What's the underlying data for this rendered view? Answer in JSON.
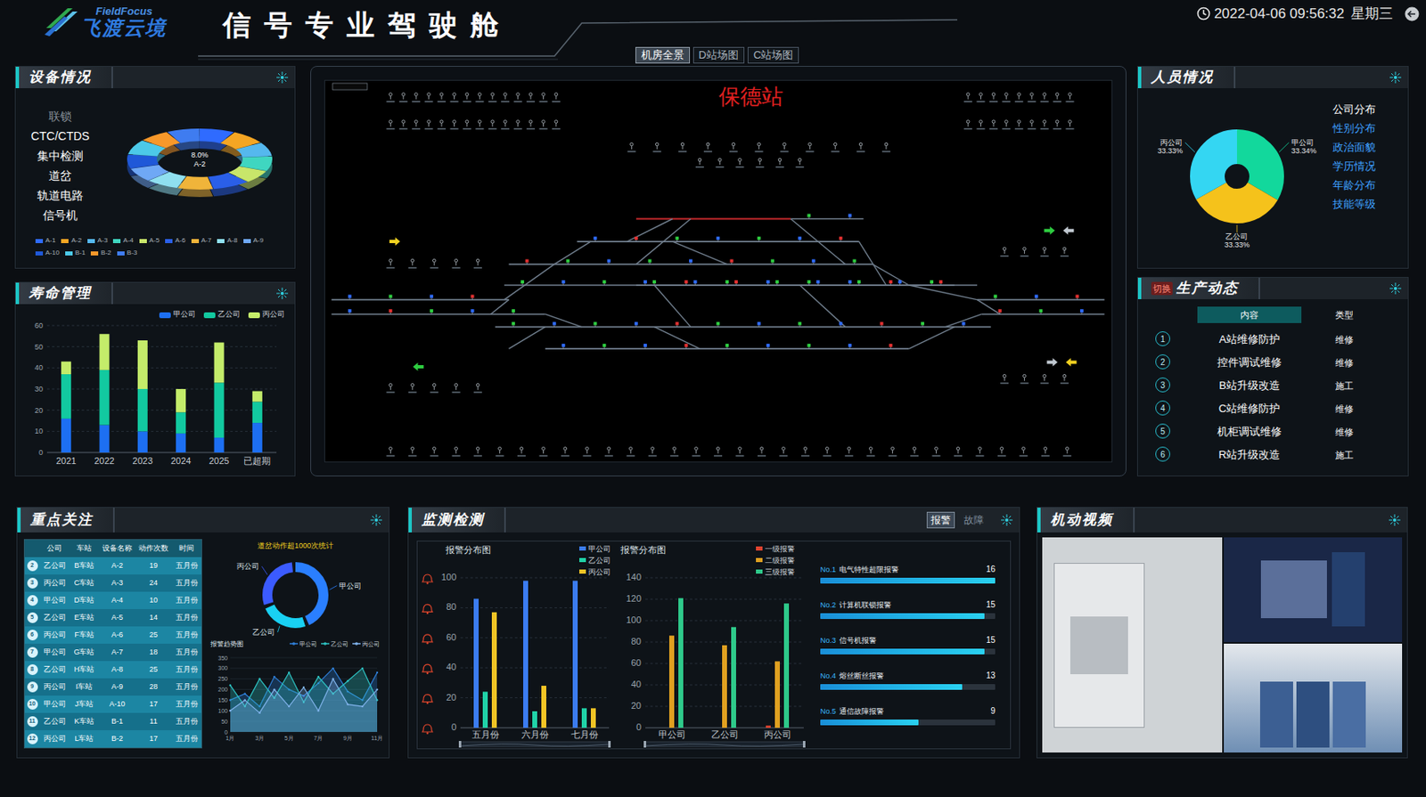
{
  "header": {
    "logo_en": "FieldFocus",
    "logo_cn": "飞渡云境",
    "title": "信号专业驾驶舱",
    "date": "2022-04-06 09:56:32",
    "weekday": "星期三"
  },
  "view_tabs": [
    {
      "label": "机房全景",
      "selected": true
    },
    {
      "label": "D站场图",
      "selected": false
    },
    {
      "label": "C站场图",
      "selected": false
    }
  ],
  "equipment": {
    "title": "设备情况",
    "categories": [
      {
        "label": "联锁",
        "muted": true
      },
      {
        "label": "CTC/CTDS",
        "muted": false
      },
      {
        "label": "集中检测",
        "muted": false
      },
      {
        "label": "道岔",
        "muted": false
      },
      {
        "label": "轨道电路",
        "muted": false
      },
      {
        "label": "信号机",
        "muted": false
      }
    ],
    "donut": {
      "center_value": "8.0%",
      "center_label": "A-2",
      "segments": [
        {
          "label": "A-1",
          "value": 8,
          "color": "#2f6bff"
        },
        {
          "label": "A-2",
          "value": 8,
          "color": "#f5a623"
        },
        {
          "label": "A-3",
          "value": 7.5,
          "color": "#55b8ee"
        },
        {
          "label": "A-4",
          "value": 8,
          "color": "#3fd6c0"
        },
        {
          "label": "A-5",
          "value": 7,
          "color": "#c8e66a"
        },
        {
          "label": "A-6",
          "value": 8.5,
          "color": "#2a5fe8"
        },
        {
          "label": "A-7",
          "value": 8,
          "color": "#f0b43a"
        },
        {
          "label": "A-8",
          "value": 7.5,
          "color": "#8fe0f0"
        },
        {
          "label": "A-9",
          "value": 7.5,
          "color": "#6fa8f5"
        },
        {
          "label": "A-10",
          "value": 7.5,
          "color": "#1f58d8"
        },
        {
          "label": "B-1",
          "value": 8,
          "color": "#4cc9e8"
        },
        {
          "label": "B-2",
          "value": 7,
          "color": "#f7982a"
        },
        {
          "label": "B-3",
          "value": 7.5,
          "color": "#3f7cf0"
        }
      ]
    }
  },
  "lifespan": {
    "title": "寿命管理",
    "y_ticks": [
      "0",
      "10",
      "20",
      "30",
      "40",
      "50",
      "60"
    ],
    "x_labels": [
      "2021",
      "2022",
      "2023",
      "2024",
      "2025",
      "已超期"
    ],
    "series": [
      {
        "name": "甲公司",
        "color": "#1d6ff2",
        "values": [
          16,
          13,
          10,
          9,
          7,
          14
        ]
      },
      {
        "name": "乙公司",
        "color": "#12c9a0",
        "values": [
          21,
          26,
          20,
          10,
          26,
          10
        ]
      },
      {
        "name": "丙公司",
        "color": "#c4ec6a",
        "values": [
          6,
          17,
          23,
          11,
          19,
          5
        ]
      }
    ]
  },
  "station": {
    "name": "保德站"
  },
  "personnel": {
    "title": "人员情况",
    "pie": [
      {
        "label": "甲公司",
        "percent": "33.34%",
        "value": 33.34,
        "color": "#12d89c"
      },
      {
        "label": "乙公司",
        "percent": "33.33%",
        "value": 33.33,
        "color": "#f5c21b"
      },
      {
        "label": "丙公司",
        "percent": "33.33%",
        "value": 33.33,
        "color": "#34d6f2"
      }
    ],
    "menu": [
      {
        "label": "公司分布",
        "selected": true
      },
      {
        "label": "性别分布",
        "selected": false
      },
      {
        "label": "政治面貌",
        "selected": false
      },
      {
        "label": "学历情况",
        "selected": false
      },
      {
        "label": "年龄分布",
        "selected": false
      },
      {
        "label": "技能等级",
        "selected": false
      }
    ]
  },
  "production": {
    "switch": "切换",
    "title": "生产动态",
    "columns": [
      "内容",
      "类型"
    ],
    "rows": [
      {
        "no": "1",
        "content": "A站维修防护",
        "type": "维修"
      },
      {
        "no": "2",
        "content": "控件调试维修",
        "type": "维修"
      },
      {
        "no": "3",
        "content": "B站升级改造",
        "type": "施工"
      },
      {
        "no": "4",
        "content": "C站维修防护",
        "type": "维修"
      },
      {
        "no": "5",
        "content": "机柜调试维修",
        "type": "维修"
      },
      {
        "no": "6",
        "content": "R站升级改造",
        "type": "施工"
      }
    ]
  },
  "focus": {
    "title": "重点关注",
    "columns": [
      "公司",
      "车站",
      "设备名称",
      "动作次数",
      "时间"
    ],
    "rows": [
      {
        "no": "2",
        "cells": [
          "乙公司",
          "B车站",
          "A-2",
          "19",
          "五月份"
        ]
      },
      {
        "no": "3",
        "cells": [
          "丙公司",
          "C车站",
          "A-3",
          "24",
          "五月份"
        ]
      },
      {
        "no": "4",
        "cells": [
          "甲公司",
          "D车站",
          "A-4",
          "10",
          "五月份"
        ]
      },
      {
        "no": "5",
        "cells": [
          "乙公司",
          "E车站",
          "A-5",
          "14",
          "五月份"
        ]
      },
      {
        "no": "6",
        "cells": [
          "丙公司",
          "F车站",
          "A-6",
          "25",
          "五月份"
        ]
      },
      {
        "no": "7",
        "cells": [
          "甲公司",
          "G车站",
          "A-7",
          "18",
          "五月份"
        ]
      },
      {
        "no": "8",
        "cells": [
          "乙公司",
          "H车站",
          "A-8",
          "25",
          "五月份"
        ]
      },
      {
        "no": "9",
        "cells": [
          "丙公司",
          "I车站",
          "A-9",
          "28",
          "五月份"
        ]
      },
      {
        "no": "10",
        "cells": [
          "甲公司",
          "J车站",
          "A-10",
          "17",
          "五月份"
        ]
      },
      {
        "no": "11",
        "cells": [
          "乙公司",
          "K车站",
          "B-1",
          "11",
          "五月份"
        ]
      },
      {
        "no": "12",
        "cells": [
          "丙公司",
          "L车站",
          "B-2",
          "17",
          "五月份"
        ]
      }
    ],
    "ring": {
      "title": "道岔动作超1000次统计",
      "segments": [
        {
          "label": "甲公司",
          "value": 45,
          "color": "#2a7fff"
        },
        {
          "label": "乙公司",
          "value": 25,
          "color": "#19d0f2"
        },
        {
          "label": "丙公司",
          "value": 30,
          "color": "#3b5bff"
        }
      ]
    },
    "trend": {
      "title": "报警趋势图",
      "y_ticks": [
        "0",
        "50",
        "100",
        "150",
        "200",
        "250",
        "300",
        "350"
      ],
      "x_labels": [
        "1月",
        "3月",
        "5月",
        "7月",
        "9月",
        "11月"
      ],
      "series": [
        {
          "name": "甲公司",
          "color": "#2f7fd8",
          "values": [
            150,
            180,
            120,
            260,
            200,
            170,
            230,
            300,
            190,
            150,
            280
          ]
        },
        {
          "name": "乙公司",
          "color": "#2ec2c2",
          "values": [
            220,
            120,
            250,
            160,
            280,
            140,
            260,
            180,
            240,
            300,
            150
          ]
        },
        {
          "name": "丙公司",
          "color": "#7fb2ea",
          "values": [
            100,
            150,
            90,
            200,
            120,
            210,
            100,
            250,
            130,
            120,
            200
          ]
        }
      ]
    }
  },
  "monitor": {
    "title": "监测检测",
    "tabs": [
      {
        "label": "报警",
        "selected": true
      },
      {
        "label": "故障",
        "selected": false
      }
    ],
    "chart_company": {
      "title": "报警分布图",
      "y_ticks": [
        "0",
        "20",
        "40",
        "60",
        "80",
        "100"
      ],
      "x_labels": [
        "五月份",
        "六月份",
        "七月份"
      ],
      "series": [
        {
          "name": "甲公司",
          "color": "#3b7cf0",
          "values": [
            86,
            98,
            98
          ]
        },
        {
          "name": "乙公司",
          "color": "#20d3a8",
          "values": [
            24,
            11,
            13
          ]
        },
        {
          "name": "丙公司",
          "color": "#f2c425",
          "values": [
            77,
            28,
            13
          ]
        }
      ]
    },
    "chart_level": {
      "title": "报警分布图",
      "y_ticks": [
        "0",
        "20",
        "40",
        "60",
        "80",
        "100",
        "120",
        "140"
      ],
      "x_labels": [
        "甲公司",
        "乙公司",
        "丙公司"
      ],
      "series": [
        {
          "name": "一级报警",
          "color": "#e0432f",
          "values": [
            0,
            0,
            2
          ]
        },
        {
          "name": "二级报警",
          "color": "#e0a020",
          "values": [
            86,
            77,
            62
          ]
        },
        {
          "name": "三级报警",
          "color": "#2ec98a",
          "values": [
            121,
            94,
            116
          ]
        }
      ]
    },
    "ranking": [
      {
        "rank": "No.1",
        "label": "电气特性超限报警",
        "count": "16",
        "level": 1
      },
      {
        "rank": "No.2",
        "label": "计算机联锁报警",
        "count": "15",
        "level": 0.94
      },
      {
        "rank": "No.3",
        "label": "信号机报警",
        "count": "15",
        "level": 0.94
      },
      {
        "rank": "No.4",
        "label": "熔丝断丝报警",
        "count": "13",
        "level": 0.81
      },
      {
        "rank": "No.5",
        "label": "通信故障报警",
        "count": "9",
        "level": 0.56
      }
    ]
  },
  "video": {
    "title": "机动视频"
  }
}
